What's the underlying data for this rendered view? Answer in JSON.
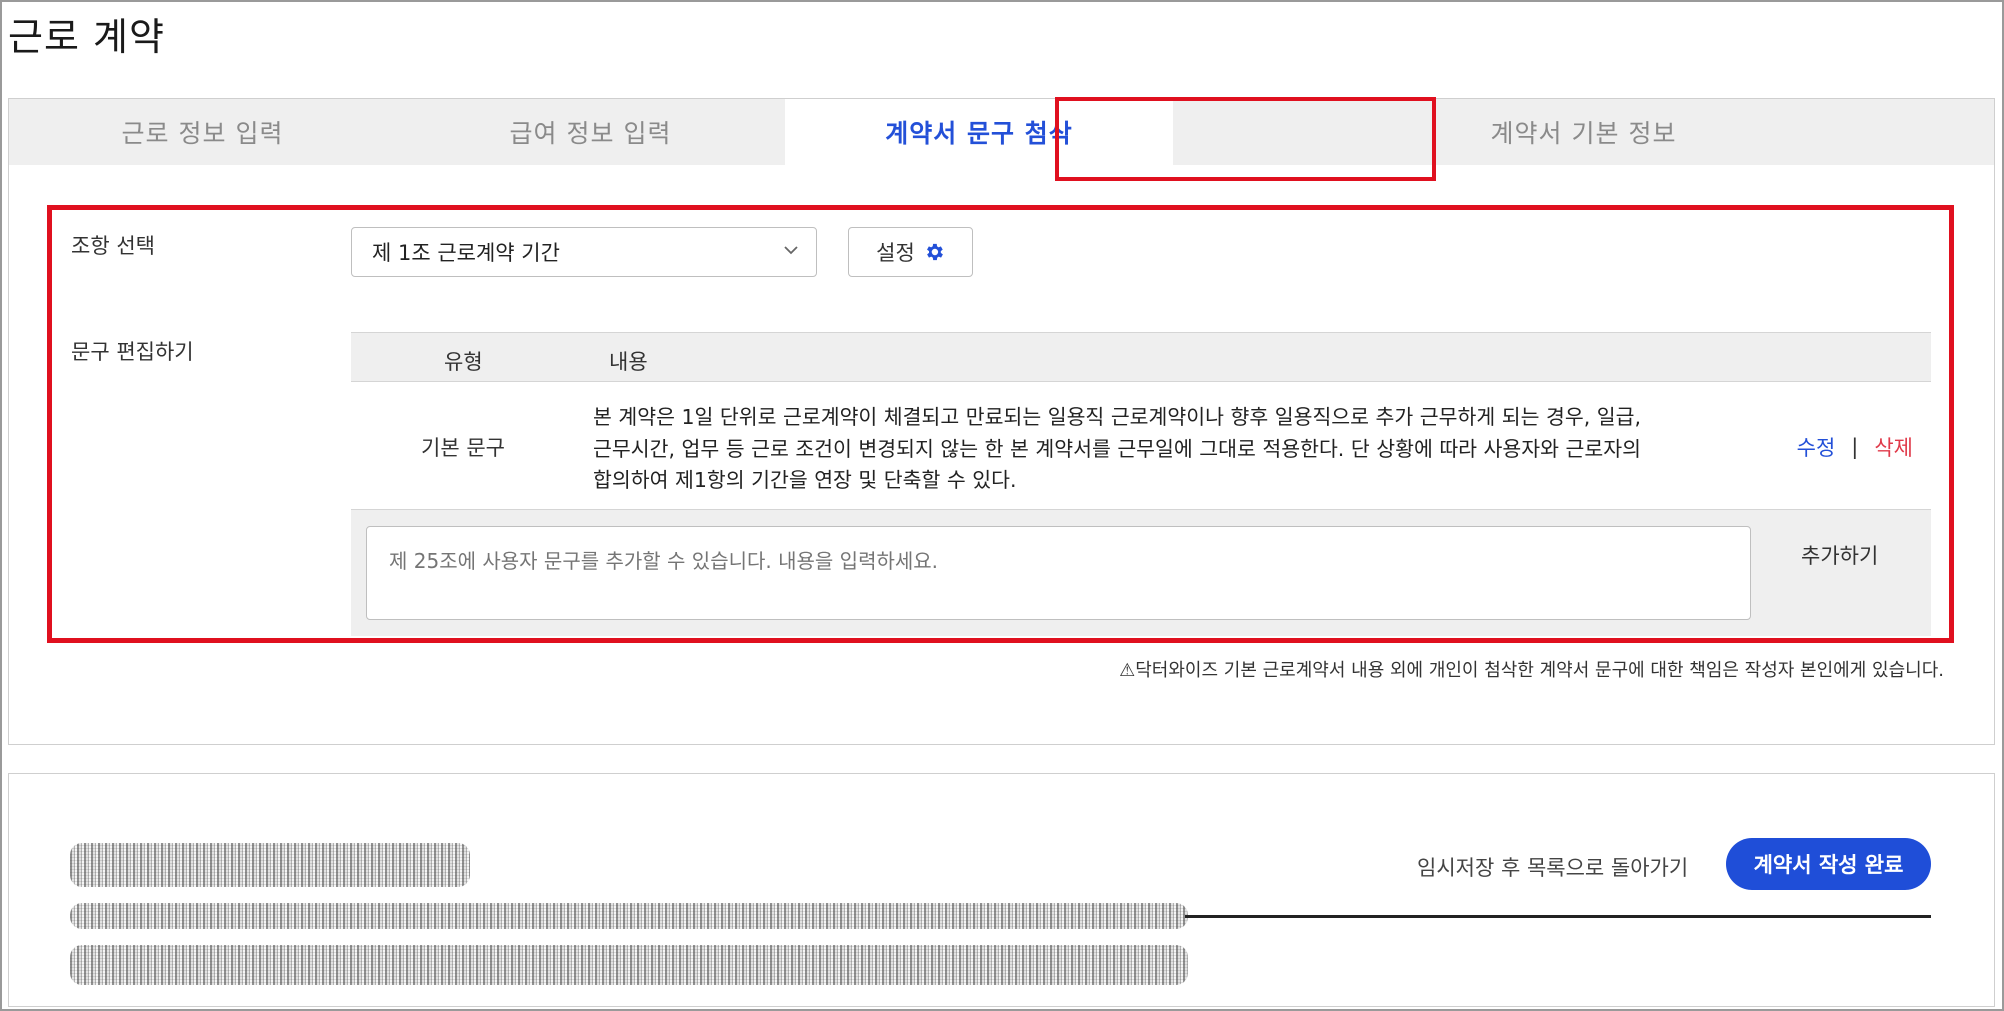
{
  "page": {
    "title": "근로 계약"
  },
  "tabs": [
    {
      "label": "근로 정보 입력"
    },
    {
      "label": "급여 정보 입력"
    },
    {
      "label": "계약서 문구 첨삭"
    },
    {
      "label": "계약서 기본 정보"
    }
  ],
  "active_tab_index": 2,
  "clause": {
    "label": "조항 선택",
    "selected": "제 1조 근로계약 기간",
    "settings_label": "설정",
    "settings_icon": "gear-icon"
  },
  "editor": {
    "label": "문구 편집하기",
    "headers": {
      "type": "유형",
      "content": "내용"
    },
    "rows": [
      {
        "type": "기본 문구",
        "content": "본 계약은 1일 단위로 근로계약이 체결되고 만료되는 일용직 근로계약이나 향후 일용직으로 추가 근무하게 되는 경우, 일급, 근무시간, 업무 등 근로 조건이 변경되지 않는 한 본 계약서를 근무일에 그대로 적용한다. 단 상황에 따라 사용자와 근로자의 합의하여 제1항의 기간을 연장 및 단축할 수 있다.",
        "edit_label": "수정",
        "separator": "|",
        "delete_label": "삭제"
      }
    ],
    "add_placeholder": "제 25조에 사용자 문구를 추가할 수 있습니다. 내용을 입력하세요.",
    "add_label": "추가하기"
  },
  "disclaimer": "⚠닥터와이즈 기본 근로계약서 내용 외에 개인이 첨삭한 계약서 문구에 대한 책임은 작성자 본인에게 있습니다.",
  "footer": {
    "save_label": "임시저장 후 목록으로 돌아가기",
    "complete_label": "계약서 작성 완료"
  },
  "colors": {
    "accent": "#2350d8",
    "highlight": "#e0101f",
    "delete": "#e03a4a",
    "primary_button": "#1f4ed8"
  }
}
